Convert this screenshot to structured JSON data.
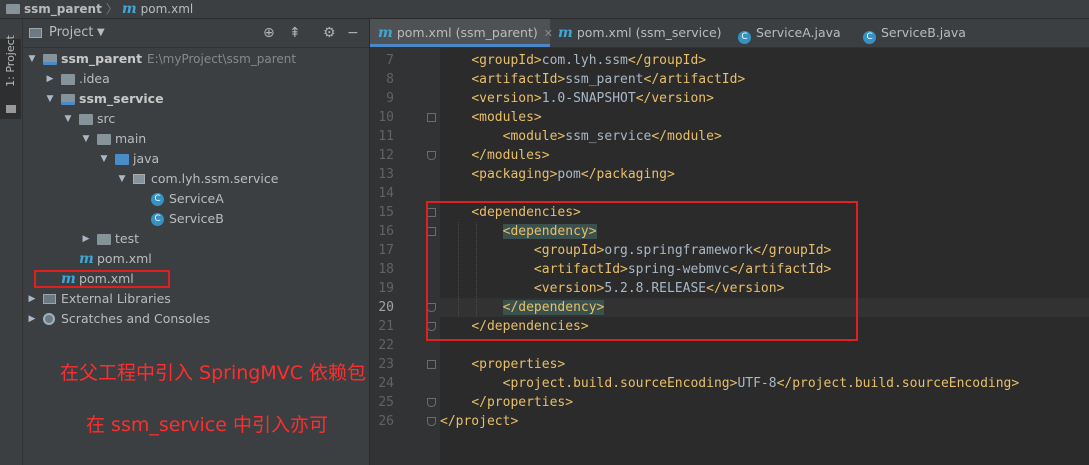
{
  "breadcrumb": {
    "project": "ssm_parent",
    "file": "pom.xml"
  },
  "left_strip": {
    "label": "1: Project"
  },
  "project_panel": {
    "title": "Project",
    "tree": [
      {
        "label": "ssm_parent",
        "path": "E:\\myProject\\ssm_parent",
        "depth": 0,
        "expanded": true,
        "icon": "module-folder-icon",
        "bold": true
      },
      {
        "label": ".idea",
        "depth": 1,
        "expanded": false,
        "icon": "folder-icon"
      },
      {
        "label": "ssm_service",
        "depth": 1,
        "expanded": true,
        "icon": "module-folder-icon",
        "bold": true
      },
      {
        "label": "src",
        "depth": 2,
        "expanded": true,
        "icon": "folder-icon"
      },
      {
        "label": "main",
        "depth": 3,
        "expanded": true,
        "icon": "folder-icon"
      },
      {
        "label": "java",
        "depth": 4,
        "expanded": true,
        "icon": "source-folder-icon"
      },
      {
        "label": "com.lyh.ssm.service",
        "depth": 5,
        "expanded": true,
        "icon": "package-icon"
      },
      {
        "label": "ServiceA",
        "depth": 6,
        "icon": "class-icon"
      },
      {
        "label": "ServiceB",
        "depth": 6,
        "icon": "class-icon"
      },
      {
        "label": "test",
        "depth": 3,
        "expanded": false,
        "icon": "folder-icon"
      },
      {
        "label": "pom.xml",
        "depth": 2,
        "icon": "maven-icon"
      },
      {
        "label": "pom.xml",
        "depth": 1,
        "icon": "maven-icon"
      },
      {
        "label": "External Libraries",
        "depth": 0,
        "expanded": false,
        "icon": "library-icon"
      },
      {
        "label": "Scratches and Consoles",
        "depth": 0,
        "expanded": false,
        "icon": "scratch-icon"
      }
    ]
  },
  "annotations": {
    "line1": "在父工程中引入 SpringMVC 依赖包",
    "line2": "在 ssm_service 中引入亦可"
  },
  "tabs": [
    {
      "label": "pom.xml (ssm_parent)",
      "icon": "maven-icon",
      "active": true,
      "closable": true
    },
    {
      "label": "pom.xml (ssm_service)",
      "icon": "maven-icon",
      "active": false
    },
    {
      "label": "ServiceA.java",
      "icon": "class-icon",
      "active": false
    },
    {
      "label": "ServiceB.java",
      "icon": "class-icon",
      "active": false
    }
  ],
  "editor": {
    "current_line": 20,
    "lines": [
      {
        "n": "7",
        "code": "    <groupId>com.lyh.ssm</groupId>"
      },
      {
        "n": "8",
        "code": "    <artifactId>ssm_parent</artifactId>"
      },
      {
        "n": "9",
        "code": "    <version>1.0-SNAPSHOT</version>"
      },
      {
        "n": "10",
        "code": "    <modules>"
      },
      {
        "n": "11",
        "code": "        <module>ssm_service</module>"
      },
      {
        "n": "12",
        "code": "    </modules>"
      },
      {
        "n": "13",
        "code": "    <packaging>pom</packaging>"
      },
      {
        "n": "14",
        "code": ""
      },
      {
        "n": "15",
        "code": "    <dependencies>"
      },
      {
        "n": "16",
        "code": "        <dependency>"
      },
      {
        "n": "17",
        "code": "            <groupId>org.springframework</groupId>"
      },
      {
        "n": "18",
        "code": "            <artifactId>spring-webmvc</artifactId>"
      },
      {
        "n": "19",
        "code": "            <version>5.2.8.RELEASE</version>"
      },
      {
        "n": "20",
        "code": "        </dependency>"
      },
      {
        "n": "21",
        "code": "    </dependencies>"
      },
      {
        "n": "22",
        "code": ""
      },
      {
        "n": "23",
        "code": "    <properties>"
      },
      {
        "n": "24",
        "code": "        <project.build.sourceEncoding>UTF-8</project.build.sourceEncoding>"
      },
      {
        "n": "25",
        "code": "    </properties>"
      },
      {
        "n": "26",
        "code": "</project>"
      }
    ]
  },
  "colors": {
    "tag": "#e8bf6a",
    "text": "#a9b7c6",
    "annotation_red": "#ff2e2e",
    "highlight_box_red": "#e02020",
    "tag_match_bg": "#3b514d"
  }
}
